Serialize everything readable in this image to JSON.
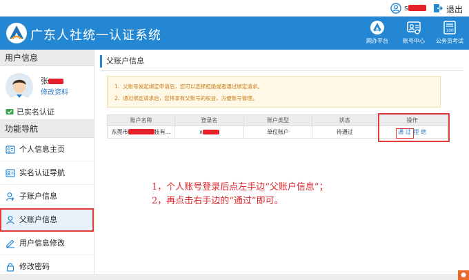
{
  "topbar": {
    "username_visible": "s",
    "logout_label": "退出"
  },
  "header": {
    "title": "广东人社统一认证系统",
    "nav": [
      {
        "label": "网办平台",
        "icon": "portal-icon"
      },
      {
        "label": "账号中心",
        "icon": "account-center-icon"
      },
      {
        "label": "公务员考试",
        "icon": "exam-icon"
      }
    ]
  },
  "sidebar": {
    "user_section_title": "用户信息",
    "user_name_visible": "张",
    "edit_profile_label": "修改资料",
    "verified_label": "已实名认证",
    "nav_section_title": "功能导航",
    "items": [
      {
        "label": "个人信息主页",
        "icon": "id-card-icon"
      },
      {
        "label": "实名认证导航",
        "icon": "verify-card-icon"
      },
      {
        "label": "子账户信息",
        "icon": "sub-account-icon"
      },
      {
        "label": "父账户信息",
        "icon": "parent-account-icon"
      },
      {
        "label": "用户信息修改",
        "icon": "edit-icon"
      },
      {
        "label": "修改密码",
        "icon": "lock-icon"
      }
    ],
    "active_index": 3
  },
  "main": {
    "breadcrumb": "父账户信息",
    "notices": [
      "1、父账号发起绑定申请后，您可以选择拒绝或者通过绑定请求。",
      "2、通过绑定请求后，您将享有父账号的权益，方便账号管理。"
    ],
    "table": {
      "headers": [
        "账户名称",
        "登录名",
        "账户类型",
        "状态",
        "操作"
      ],
      "rows": [
        {
          "account_name_prefix": "东莞市",
          "account_name_suffix": "技有...",
          "login_name_prefix": "x",
          "account_type": "单位账户",
          "status": "待通过",
          "action_pass": "通 过",
          "action_reject": "拒 绝"
        }
      ]
    },
    "instructions": [
      "1，个人账号登录后点左手边“父账户信息”；",
      "2，再点击右手边的“通过”即可。"
    ]
  },
  "colors": {
    "header_blue": "#2487d4",
    "annotation_red": "#e33a3a",
    "link_blue": "#2b78c2",
    "notice_text": "#c97a12"
  }
}
